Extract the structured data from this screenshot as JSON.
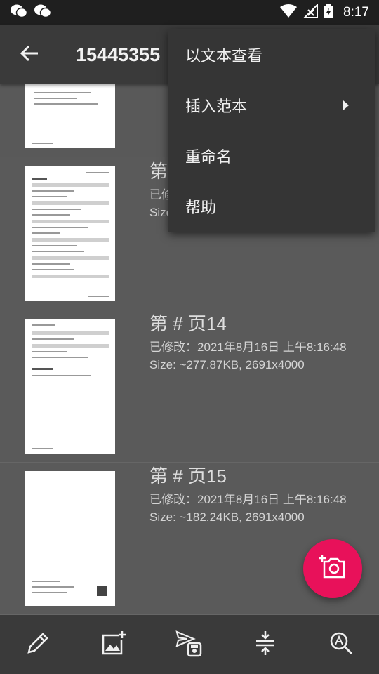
{
  "status_bar": {
    "time": "8:17",
    "left_icons": [
      "wechat-icon",
      "wechat-icon"
    ],
    "right_icons": [
      "wifi-icon",
      "no-signal-icon",
      "battery-charging-icon"
    ]
  },
  "app_bar": {
    "title": "15445355",
    "back_icon": "arrow-back-icon"
  },
  "menu": {
    "items": [
      {
        "label": "以文本查看",
        "has_submenu": false
      },
      {
        "label": "插入范本",
        "has_submenu": true
      },
      {
        "label": "重命名",
        "has_submenu": false
      },
      {
        "label": "帮助",
        "has_submenu": false
      }
    ]
  },
  "pages": [
    {
      "title": "",
      "modified": "",
      "size": ""
    },
    {
      "title": "第",
      "modified": "已修",
      "size": "Size"
    },
    {
      "title": "第 # 页14",
      "modified": "已修改：2021年8月16日 上午8:16:48",
      "size": "Size: ~277.87KB, 2691x4000"
    },
    {
      "title": "第 # 页15",
      "modified": "已修改：2021年8月16日 上午8:16:48",
      "size": "Size: ~182.24KB, 2691x4000"
    }
  ],
  "bottom_bar": {
    "buttons": [
      "edit-icon",
      "add-image-icon",
      "send-save-icon",
      "merge-icon",
      "text-search-icon"
    ]
  },
  "fab": {
    "icon": "add-camera-icon"
  },
  "colors": {
    "accent": "#e8115a",
    "app_bar": "#3a3a3a",
    "menu_bg": "#353535",
    "list_bg": "#5a5a5a"
  }
}
